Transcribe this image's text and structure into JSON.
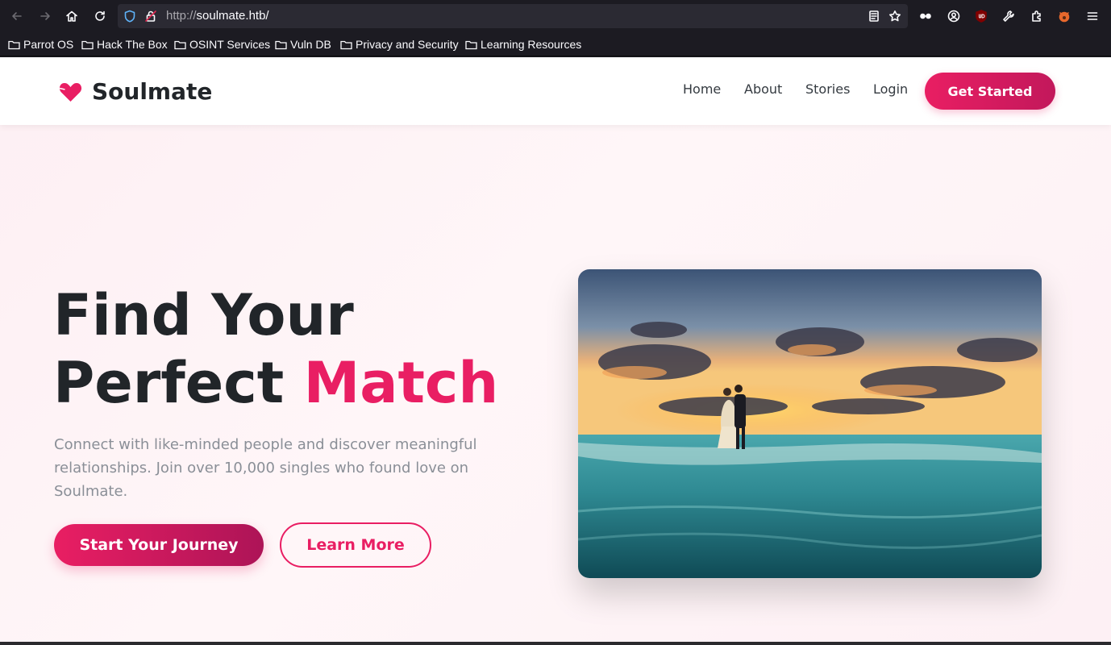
{
  "browser": {
    "url_protocol": "http://",
    "url_host": "soulmate.htb/",
    "bookmarks": [
      "Parrot OS",
      "Hack The Box",
      "OSINT Services",
      "Vuln DB",
      "Privacy and Security",
      "Learning Resources"
    ]
  },
  "site": {
    "brand": "Soulmate",
    "brand_color": "#e91e63",
    "nav": {
      "home": "Home",
      "about": "About",
      "stories": "Stories",
      "login": "Login",
      "cta": "Get Started"
    },
    "hero": {
      "title_line1": "Find Your",
      "title_line2_plain": "Perfect ",
      "title_line2_accent": "Match",
      "subtitle": "Connect with like-minded people and discover meaningful relationships. Join over 10,000 singles who found love on Soulmate.",
      "primary_button": "Start Your Journey",
      "secondary_button": "Learn More"
    }
  }
}
